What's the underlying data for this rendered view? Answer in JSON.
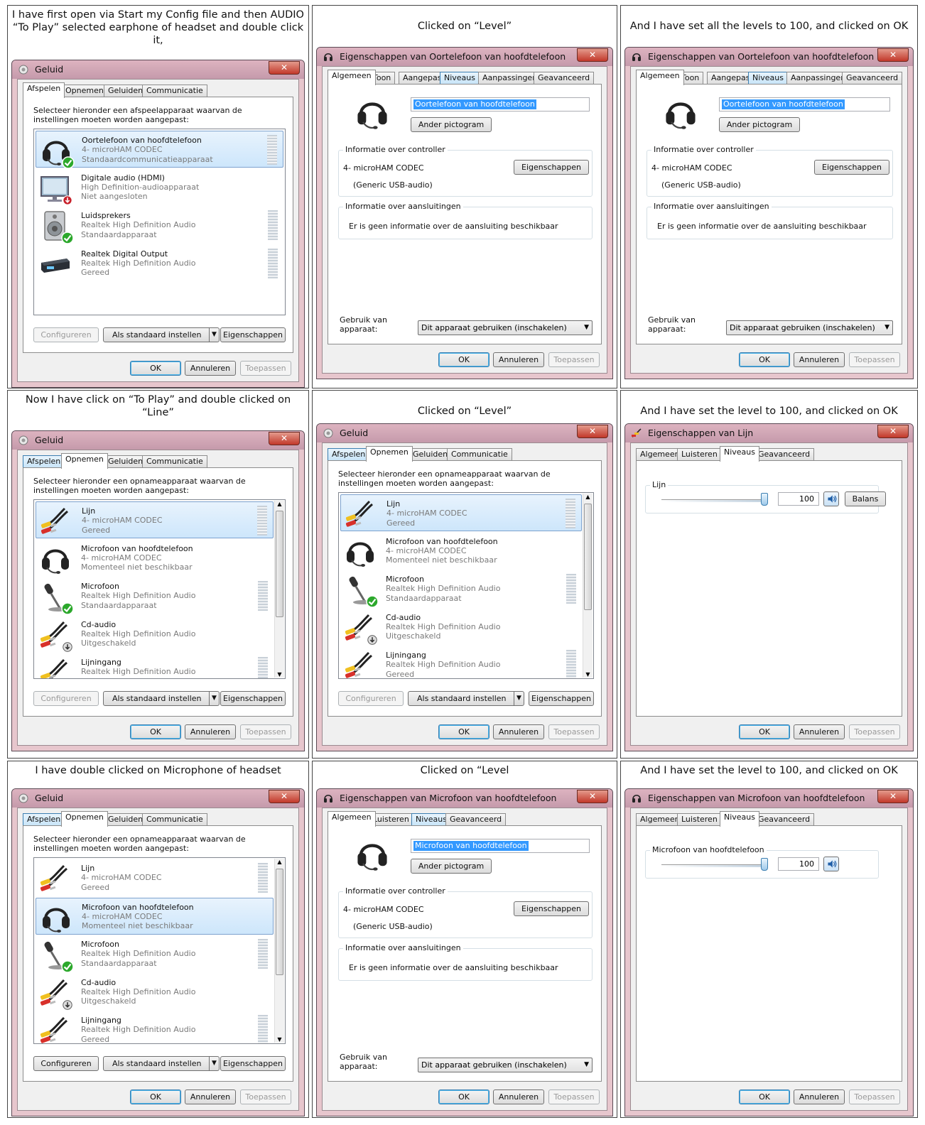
{
  "captions": [
    "I have first open via Start my Config file and then AUDIO “To Play” selected earphone of headset and double click it,",
    "Clicked on “Level”",
    "And I have set all the levels to 100, and clicked on OK",
    "Now I have click on “To Play” and double clicked on “Line”",
    "Clicked on “Level”",
    "And I have set the level to 100, and clicked on OK",
    "I have double clicked on Microphone of headset",
    "Clicked on “Level",
    "And I have set the level to 100, and clicked on OK"
  ],
  "sound": {
    "title": "Geluid",
    "tabs": [
      "Afspelen",
      "Opnemen",
      "Geluiden",
      "Communicatie"
    ],
    "instr_play": "Selecteer hieronder een afspeelapparaat waarvan de instellingen moeten worden aangepast:",
    "instr_rec": "Selecteer hieronder een opnameapparaat waarvan de instellingen moeten worden aangepast:",
    "configure": "Configureren",
    "set_default": "Als standaard instellen",
    "properties": "Eigenschappen"
  },
  "playback_devices": [
    {
      "name": "Oortelefoon van hoofdtelefoon",
      "driver": "4- microHAM CODEC",
      "status": "Standaardcommunicatieapparaat",
      "icon": "headset-icon"
    },
    {
      "name": "Digitale audio (HDMI)",
      "driver": "High Definition-audioapparaat",
      "status": "Niet aangesloten",
      "icon": "monitor-icon"
    },
    {
      "name": "Luidsprekers",
      "driver": "Realtek High Definition Audio",
      "status": "Standaardapparaat",
      "icon": "speaker-icon"
    },
    {
      "name": "Realtek Digital Output",
      "driver": "Realtek High Definition Audio",
      "status": "Gereed",
      "icon": "digital-output-icon"
    }
  ],
  "recording_devices": [
    {
      "name": "Lijn",
      "driver": "4- microHAM CODEC",
      "status": "Gereed",
      "icon": "cable-icon"
    },
    {
      "name": "Microfoon van hoofdtelefoon",
      "driver": "4- microHAM CODEC",
      "status": "Momenteel niet beschikbaar",
      "icon": "headset-icon"
    },
    {
      "name": "Microfoon",
      "driver": "Realtek High Definition Audio",
      "status": "Standaardapparaat",
      "icon": "microphone-icon"
    },
    {
      "name": "Cd-audio",
      "driver": "Realtek High Definition Audio",
      "status": "Uitgeschakeld",
      "icon": "cable-icon"
    },
    {
      "name": "Lijningang",
      "driver": "Realtek High Definition Audio",
      "status": "Gereed",
      "icon": "cable-icon"
    }
  ],
  "props": {
    "title_earphone": "Eigenschappen van Oortelefoon van hoofdtelefoon",
    "title_line": "Eigenschappen van Lijn",
    "title_mic": "Eigenschappen van Microfoon van hoofdtelefoon",
    "tabs_playback": [
      "Algemeen",
      "Toon",
      "Aangepast",
      "Niveaus",
      "Aanpassingen",
      "Geavanceerd"
    ],
    "tabs_recording": [
      "Algemeen",
      "Luisteren",
      "Niveaus",
      "Geavanceerd"
    ],
    "name_earphone": "Oortelefoon van hoofdtelefoon",
    "name_mic": "Microfoon van hoofdtelefoon",
    "change_icon": "Ander pictogram",
    "controller_group": "Informatie over controller",
    "controller_name": "4- microHAM CODEC",
    "controller_type": "(Generic USB-audio)",
    "properties": "Eigenschappen",
    "jack_group": "Informatie over aansluitingen",
    "jack_info": "Er is geen informatie over de aansluiting beschikbaar",
    "usage_label": "Gebruik van apparaat:",
    "usage_value": "Dit apparaat gebruiken (inschakelen)",
    "level_line": "Lijn",
    "level_mic": "Microfoon van hoofdtelefoon",
    "level_value": "100",
    "balance": "Balans"
  },
  "buttons": {
    "ok": "OK",
    "cancel": "Annuleren",
    "apply": "Toepassen"
  },
  "colors": {
    "accent": "#3399ff",
    "titlebar": "#d4a8b6",
    "close": "#c2382a"
  }
}
